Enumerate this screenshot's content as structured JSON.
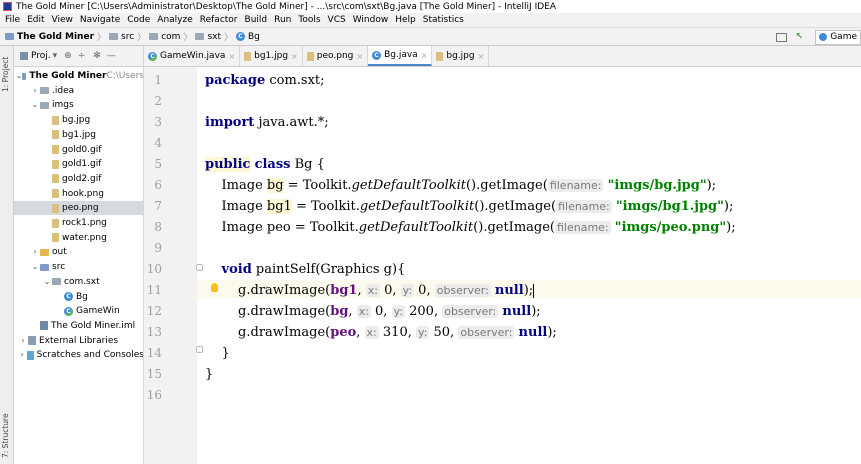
{
  "window": {
    "title": "The Gold Miner [C:\\Users\\Administrator\\Desktop\\The Gold Miner] - ...\\src\\com\\sxt\\Bg.java [The Gold Miner] - IntelliJ IDEA"
  },
  "menu": [
    "File",
    "Edit",
    "View",
    "Navigate",
    "Code",
    "Analyze",
    "Refactor",
    "Build",
    "Run",
    "Tools",
    "VCS",
    "Window",
    "Help",
    "Statistics"
  ],
  "breadcrumb": {
    "project": "The Gold Miner",
    "items": [
      "src",
      "com",
      "sxt",
      "Bg"
    ],
    "run_config": "Game"
  },
  "left_tool": {
    "project_label": "1: Project",
    "structure_label": "7: Structure"
  },
  "project_panel": {
    "title": "Proj.",
    "tree": [
      {
        "label": "The Gold Miner",
        "suffix": "C:\\Users",
        "indent": 0,
        "arrow": "v",
        "icon": "folder-blue",
        "bold": true
      },
      {
        "label": ".idea",
        "indent": 1,
        "arrow": ">",
        "icon": "folder"
      },
      {
        "label": "imgs",
        "indent": 1,
        "arrow": "v",
        "icon": "folder"
      },
      {
        "label": "bg.jpg",
        "indent": 2,
        "arrow": "",
        "icon": "file"
      },
      {
        "label": "bg1.jpg",
        "indent": 2,
        "arrow": "",
        "icon": "file"
      },
      {
        "label": "gold0.gif",
        "indent": 2,
        "arrow": "",
        "icon": "file"
      },
      {
        "label": "gold1.gif",
        "indent": 2,
        "arrow": "",
        "icon": "file"
      },
      {
        "label": "gold2.gif",
        "indent": 2,
        "arrow": "",
        "icon": "file"
      },
      {
        "label": "hook.png",
        "indent": 2,
        "arrow": "",
        "icon": "file"
      },
      {
        "label": "peo.png",
        "indent": 2,
        "arrow": "",
        "icon": "file",
        "selected": true
      },
      {
        "label": "rock1.png",
        "indent": 2,
        "arrow": "",
        "icon": "file"
      },
      {
        "label": "water.png",
        "indent": 2,
        "arrow": "",
        "icon": "file"
      },
      {
        "label": "out",
        "indent": 1,
        "arrow": ">",
        "icon": "folder-yellow"
      },
      {
        "label": "src",
        "indent": 1,
        "arrow": "v",
        "icon": "folder-blue"
      },
      {
        "label": "com.sxt",
        "indent": 2,
        "arrow": "v",
        "icon": "folder"
      },
      {
        "label": "Bg",
        "indent": 3,
        "arrow": "",
        "icon": "class"
      },
      {
        "label": "GameWin",
        "indent": 3,
        "arrow": "",
        "icon": "class-run"
      },
      {
        "label": "The Gold Miner.iml",
        "indent": 1,
        "arrow": "",
        "icon": "iml"
      },
      {
        "label": "External Libraries",
        "indent": 0,
        "arrow": ">",
        "icon": "library"
      },
      {
        "label": "Scratches and Consoles",
        "indent": 0,
        "arrow": ">",
        "icon": "scratch"
      }
    ]
  },
  "tabs": [
    {
      "label": "GameWin.java",
      "icon": "class-run",
      "active": false
    },
    {
      "label": "bg1.jpg",
      "icon": "file",
      "active": false
    },
    {
      "label": "peo.png",
      "icon": "file",
      "active": false
    },
    {
      "label": "Bg.java",
      "icon": "class",
      "active": true
    },
    {
      "label": "bg.jpg",
      "icon": "file",
      "active": false
    }
  ],
  "editor": {
    "line_numbers": [
      "1",
      "2",
      "3",
      "4",
      "5",
      "6",
      "7",
      "8",
      "9",
      "10",
      "11",
      "12",
      "13",
      "14",
      "15",
      "16"
    ],
    "lines": [
      {
        "tokens": [
          {
            "t": "package",
            "c": "kw"
          },
          {
            "t": " com.sxt;"
          }
        ]
      },
      {
        "tokens": []
      },
      {
        "tokens": [
          {
            "t": "import",
            "c": "kw"
          },
          {
            "t": " java.awt.*;"
          }
        ]
      },
      {
        "tokens": []
      },
      {
        "tokens": [
          {
            "t": "public",
            "c": "kw warn"
          },
          {
            "t": " "
          },
          {
            "t": "class",
            "c": "kw"
          },
          {
            "t": " Bg {"
          }
        ]
      },
      {
        "tokens": [
          {
            "t": "    Image "
          },
          {
            "t": "bg",
            "c": "warn"
          },
          {
            "t": " = Toolkit."
          },
          {
            "t": "getDefaultToolkit",
            "c": "it"
          },
          {
            "t": "().getImage("
          },
          {
            "t": "filename:",
            "c": "hint"
          },
          {
            "t": " "
          },
          {
            "t": "\"imgs/bg.jpg\"",
            "c": "str"
          },
          {
            "t": ");"
          }
        ]
      },
      {
        "tokens": [
          {
            "t": "    Image "
          },
          {
            "t": "bg1",
            "c": "warn"
          },
          {
            "t": " = Toolkit."
          },
          {
            "t": "getDefaultToolkit",
            "c": "it"
          },
          {
            "t": "().getImage("
          },
          {
            "t": "filename:",
            "c": "hint"
          },
          {
            "t": " "
          },
          {
            "t": "\"imgs/bg1.jpg\"",
            "c": "str"
          },
          {
            "t": ");"
          }
        ]
      },
      {
        "tokens": [
          {
            "t": "    Image peo = Toolkit."
          },
          {
            "t": "getDefaultToolkit",
            "c": "it"
          },
          {
            "t": "().getImage("
          },
          {
            "t": "filename:",
            "c": "hint"
          },
          {
            "t": " "
          },
          {
            "t": "\"imgs/peo.png\"",
            "c": "str"
          },
          {
            "t": ");"
          }
        ]
      },
      {
        "tokens": []
      },
      {
        "tokens": [
          {
            "t": "    "
          },
          {
            "t": "void",
            "c": "kw"
          },
          {
            "t": " paintSelf(Graphics g){"
          }
        ]
      },
      {
        "tokens": [
          {
            "t": "        g.drawImage("
          },
          {
            "t": "bg1",
            "c": "fld"
          },
          {
            "t": ", "
          },
          {
            "t": "x:",
            "c": "hint"
          },
          {
            "t": " 0, "
          },
          {
            "t": "y:",
            "c": "hint"
          },
          {
            "t": " 0, "
          },
          {
            "t": "observer:",
            "c": "hint"
          },
          {
            "t": " "
          },
          {
            "t": "null",
            "c": "kw"
          },
          {
            "t": ");"
          }
        ]
      },
      {
        "tokens": [
          {
            "t": "        g.drawImage("
          },
          {
            "t": "bg",
            "c": "fld"
          },
          {
            "t": ", "
          },
          {
            "t": "x:",
            "c": "hint"
          },
          {
            "t": " 0, "
          },
          {
            "t": "y:",
            "c": "hint"
          },
          {
            "t": " 200, "
          },
          {
            "t": "observer:",
            "c": "hint"
          },
          {
            "t": " "
          },
          {
            "t": "null",
            "c": "kw"
          },
          {
            "t": ");"
          }
        ]
      },
      {
        "tokens": [
          {
            "t": "        g.drawImage("
          },
          {
            "t": "peo",
            "c": "fld"
          },
          {
            "t": ", "
          },
          {
            "t": "x:",
            "c": "hint"
          },
          {
            "t": " 310, "
          },
          {
            "t": "y:",
            "c": "hint"
          },
          {
            "t": " 50, "
          },
          {
            "t": "observer:",
            "c": "hint"
          },
          {
            "t": " "
          },
          {
            "t": "null",
            "c": "kw"
          },
          {
            "t": ");"
          }
        ]
      },
      {
        "tokens": [
          {
            "t": "    }"
          }
        ]
      },
      {
        "tokens": [
          {
            "t": "}"
          }
        ]
      },
      {
        "tokens": []
      }
    ]
  }
}
